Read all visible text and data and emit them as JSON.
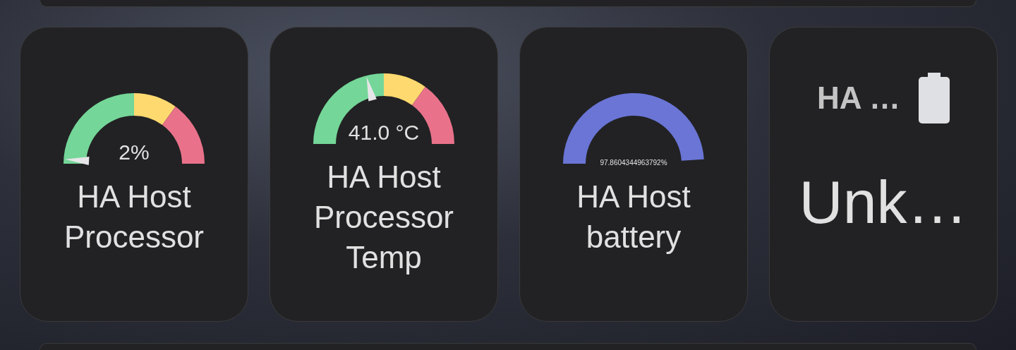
{
  "cards": [
    {
      "kind": "severity-gauge",
      "level": 0.02,
      "value": "2%",
      "name": "HA Host Processor"
    },
    {
      "kind": "severity-gauge",
      "level": 0.42,
      "value": "41.0 °C",
      "name": "HA Host Processor Temp"
    },
    {
      "kind": "plain-gauge",
      "level": 0.98,
      "value": "97.8604344963792%",
      "name": "HA Host battery"
    },
    {
      "kind": "entity",
      "name": "HA …",
      "value": "Unk…"
    }
  ]
}
